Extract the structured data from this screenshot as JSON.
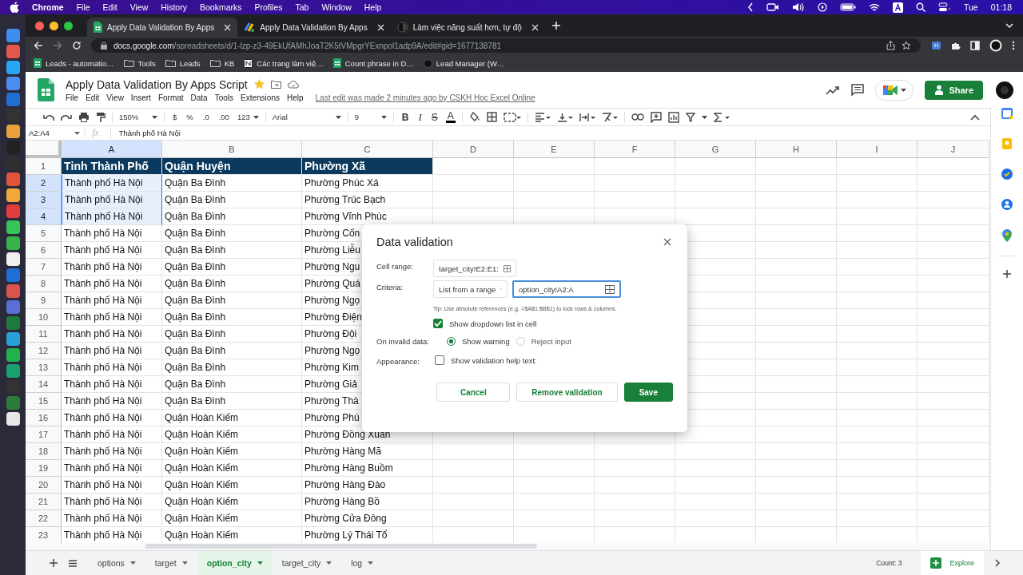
{
  "menubar": {
    "app": "Chrome",
    "items": [
      "File",
      "Edit",
      "View",
      "History",
      "Bookmarks",
      "Profiles",
      "Tab",
      "Window",
      "Help"
    ],
    "day": "Tue",
    "time": "01:18"
  },
  "browser": {
    "tabs": [
      {
        "title": "Apply Data Validation By Apps",
        "kind": "sheets",
        "selected": true
      },
      {
        "title": "Apply Data Validation By Apps",
        "kind": "script",
        "selected": false
      },
      {
        "title": "Làm việc năng suất hơn, tự độ",
        "kind": "dark",
        "selected": false
      }
    ],
    "url_host": "docs.google.com",
    "url_path": "/spreadsheets/d/1-lzp-z3-49EkUfAMhJoaT2K5tVMpgrYExnpol1adp9A/edit#gid=1677138781",
    "bookmarks": [
      {
        "label": "Leads - automatio…",
        "kind": "sheets"
      },
      {
        "label": "Tools",
        "kind": "folder"
      },
      {
        "label": "Leads",
        "kind": "folder"
      },
      {
        "label": "KB",
        "kind": "folder"
      },
      {
        "label": "Các trang làm việ…",
        "kind": "notion"
      },
      {
        "label": "Count phrase in D…",
        "kind": "sheets"
      },
      {
        "label": "Lead Manager (W…",
        "kind": "dark"
      }
    ]
  },
  "doc": {
    "title": "Apply Data Validation By Apps Script",
    "starred": true,
    "menu": [
      "File",
      "Edit",
      "View",
      "Insert",
      "Format",
      "Data",
      "Tools",
      "Extensions",
      "Help"
    ],
    "last_edit": "Last edit was made 2 minutes ago by CSKH Hoc Excel Online",
    "share": "Share"
  },
  "toolbar": {
    "zoom": "150%",
    "currency": "$",
    "percent": "%",
    "decrease_decimals": ".0",
    "increase_decimals": ".00",
    "number_format": "123",
    "font": "Arial",
    "font_size": "9",
    "bold": "B",
    "italic": "I",
    "strikethrough": "S",
    "text_color": "A"
  },
  "formula_bar": {
    "cell_ref": "A2:A4",
    "fx": "fx",
    "value": "Thành phố Hà Nội"
  },
  "grid": {
    "columns": [
      {
        "label": "A",
        "selected": true
      },
      {
        "label": "B",
        "selected": false
      },
      {
        "label": "C",
        "selected": false
      },
      {
        "label": "D",
        "selected": false
      },
      {
        "label": "E",
        "selected": false
      },
      {
        "label": "F",
        "selected": false
      },
      {
        "label": "G",
        "selected": false
      },
      {
        "label": "H",
        "selected": false
      },
      {
        "label": "I",
        "selected": false
      },
      {
        "label": "J",
        "selected": false
      }
    ],
    "rows": [
      {
        "number": "1",
        "kind": "header",
        "selected": false,
        "cells": [
          "Tỉnh Thành Phố",
          "Quận Huyện",
          "Phường Xã"
        ]
      },
      {
        "number": "2",
        "kind": "data",
        "selected": true,
        "cells": [
          "Thành phố Hà Nội",
          "Quận Ba Đình",
          "Phường Phúc Xá"
        ]
      },
      {
        "number": "3",
        "kind": "data",
        "selected": true,
        "cells": [
          "Thành phố Hà Nội",
          "Quận Ba Đình",
          "Phường Trúc Bạch"
        ]
      },
      {
        "number": "4",
        "kind": "data",
        "selected": true,
        "cells": [
          "Thành phố Hà Nội",
          "Quận Ba Đình",
          "Phường Vĩnh Phúc"
        ]
      },
      {
        "number": "5",
        "kind": "data",
        "selected": false,
        "cells": [
          "Thành phố Hà Nội",
          "Quận Ba Đình",
          "Phường Cốn"
        ]
      },
      {
        "number": "6",
        "kind": "data",
        "selected": false,
        "cells": [
          "Thành phố Hà Nội",
          "Quận Ba Đình",
          "Phường Liễu"
        ]
      },
      {
        "number": "7",
        "kind": "data",
        "selected": false,
        "cells": [
          "Thành phố Hà Nội",
          "Quận Ba Đình",
          "Phường Ngu"
        ]
      },
      {
        "number": "8",
        "kind": "data",
        "selected": false,
        "cells": [
          "Thành phố Hà Nội",
          "Quận Ba Đình",
          "Phường Quá"
        ]
      },
      {
        "number": "9",
        "kind": "data",
        "selected": false,
        "cells": [
          "Thành phố Hà Nội",
          "Quận Ba Đình",
          "Phường Ngọ"
        ]
      },
      {
        "number": "10",
        "kind": "data",
        "selected": false,
        "cells": [
          "Thành phố Hà Nội",
          "Quận Ba Đình",
          "Phường Điện"
        ]
      },
      {
        "number": "11",
        "kind": "data",
        "selected": false,
        "cells": [
          "Thành phố Hà Nội",
          "Quận Ba Đình",
          "Phường Đội"
        ]
      },
      {
        "number": "12",
        "kind": "data",
        "selected": false,
        "cells": [
          "Thành phố Hà Nội",
          "Quận Ba Đình",
          "Phường Ngọ"
        ]
      },
      {
        "number": "13",
        "kind": "data",
        "selected": false,
        "cells": [
          "Thành phố Hà Nội",
          "Quận Ba Đình",
          "Phường Kim"
        ]
      },
      {
        "number": "14",
        "kind": "data",
        "selected": false,
        "cells": [
          "Thành phố Hà Nội",
          "Quận Ba Đình",
          "Phường Giả"
        ]
      },
      {
        "number": "15",
        "kind": "data",
        "selected": false,
        "cells": [
          "Thành phố Hà Nội",
          "Quận Ba Đình",
          "Phường Thà"
        ]
      },
      {
        "number": "16",
        "kind": "data",
        "selected": false,
        "cells": [
          "Thành phố Hà Nội",
          "Quận Hoàn Kiếm",
          "Phường Phú"
        ]
      },
      {
        "number": "17",
        "kind": "data",
        "selected": false,
        "cells": [
          "Thành phố Hà Nội",
          "Quận Hoàn Kiếm",
          "Phường Đồng Xuân"
        ]
      },
      {
        "number": "18",
        "kind": "data",
        "selected": false,
        "cells": [
          "Thành phố Hà Nội",
          "Quận Hoàn Kiếm",
          "Phường Hàng Mã"
        ]
      },
      {
        "number": "19",
        "kind": "data",
        "selected": false,
        "cells": [
          "Thành phố Hà Nội",
          "Quận Hoàn Kiếm",
          "Phường Hàng Buồm"
        ]
      },
      {
        "number": "20",
        "kind": "data",
        "selected": false,
        "cells": [
          "Thành phố Hà Nội",
          "Quận Hoàn Kiếm",
          "Phường Hàng Đào"
        ]
      },
      {
        "number": "21",
        "kind": "data",
        "selected": false,
        "cells": [
          "Thành phố Hà Nội",
          "Quận Hoàn Kiếm",
          "Phường Hàng Bồ"
        ]
      },
      {
        "number": "22",
        "kind": "data",
        "selected": false,
        "cells": [
          "Thành phố Hà Nội",
          "Quận Hoàn Kiếm",
          "Phường Cửa Đông"
        ]
      },
      {
        "number": "23",
        "kind": "data",
        "selected": false,
        "cells": [
          "Thành phố Hà Nội",
          "Quận Hoàn Kiếm",
          "Phường Lý Thái Tổ"
        ]
      }
    ]
  },
  "dialog": {
    "title": "Data validation",
    "cell_range_label": "Cell range:",
    "cell_range": "target_city!E2:E1:",
    "criteria_label": "Criteria:",
    "criteria_type": "List from a range",
    "criteria_range": "option_city!A2:A",
    "tip": "Tip: Use absolute references (e.g. =$A$1:$B$1) to lock rows & columns.",
    "show_dropdown": {
      "label": "Show dropdown list in cell",
      "checked": true
    },
    "invalid_label": "On invalid data:",
    "invalid_options": [
      {
        "label": "Show warning",
        "selected": true
      },
      {
        "label": "Reject input",
        "selected": false
      }
    ],
    "appearance_label": "Appearance:",
    "help_text": {
      "label": "Show validation help text:",
      "checked": false
    },
    "buttons": {
      "cancel": "Cancel",
      "remove": "Remove validation",
      "save": "Save"
    }
  },
  "sheet_tabs": [
    {
      "label": "options",
      "selected": false
    },
    {
      "label": "target",
      "selected": false
    },
    {
      "label": "option_city",
      "selected": true
    },
    {
      "label": "target_city",
      "selected": false
    },
    {
      "label": "log",
      "selected": false
    }
  ],
  "status": {
    "count": "Count: 3",
    "explore": "Explore"
  }
}
